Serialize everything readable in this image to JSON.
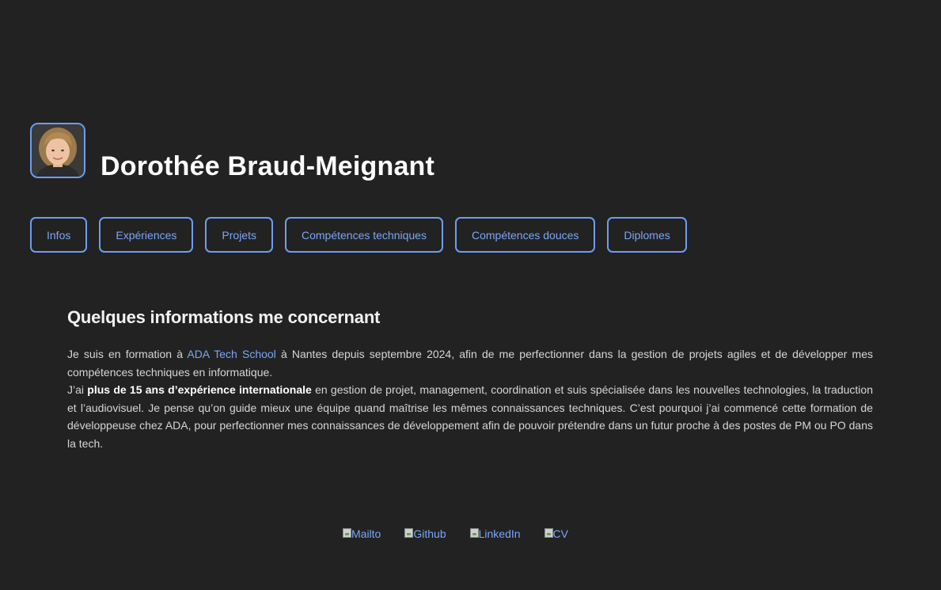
{
  "header": {
    "name": "Dorothée Braud-Meignant"
  },
  "nav": {
    "items": [
      {
        "label": "Infos"
      },
      {
        "label": "Expériences"
      },
      {
        "label": "Projets"
      },
      {
        "label": "Compétences techniques"
      },
      {
        "label": "Compétences douces"
      },
      {
        "label": "Diplomes"
      }
    ]
  },
  "about": {
    "title": "Quelques informations me concernant",
    "p1_before_link": "Je suis en formation à ",
    "p1_link": "ADA Tech School",
    "p1_after_link": " à Nantes depuis septembre 2024, afin de me perfectionner dans la gestion de projets agiles et de développer mes compétences techniques en informatique.",
    "p2_before_bold": "J’ai ",
    "p2_bold": "plus de 15 ans d’expérience internationale",
    "p2_after_bold": " en gestion de projet, management, coordination et suis spécialisée dans les nouvelles technologies, la traduction et l’audiovisuel. Je pense qu’on guide mieux une équipe quand maîtrise les mêmes connaissances techniques. C’est pourquoi j’ai commencé cette formation de développeuse chez ADA, pour perfectionner mes connaissances de développement afin de pouvoir prétendre dans un futur proche à des postes de PM ou PO dans la tech."
  },
  "footer": {
    "links": [
      {
        "label": "Mailto",
        "icon": "broken-image-icon"
      },
      {
        "label": "Github",
        "icon": "broken-image-icon"
      },
      {
        "label": "LinkedIn",
        "icon": "broken-image-icon"
      },
      {
        "label": "CV",
        "icon": "broken-image-icon"
      }
    ]
  },
  "colors": {
    "background": "#222222",
    "accent": "#6e9df0",
    "link": "#7aa7f5",
    "heading": "#ffffff",
    "body_text": "#d6d6d6"
  }
}
